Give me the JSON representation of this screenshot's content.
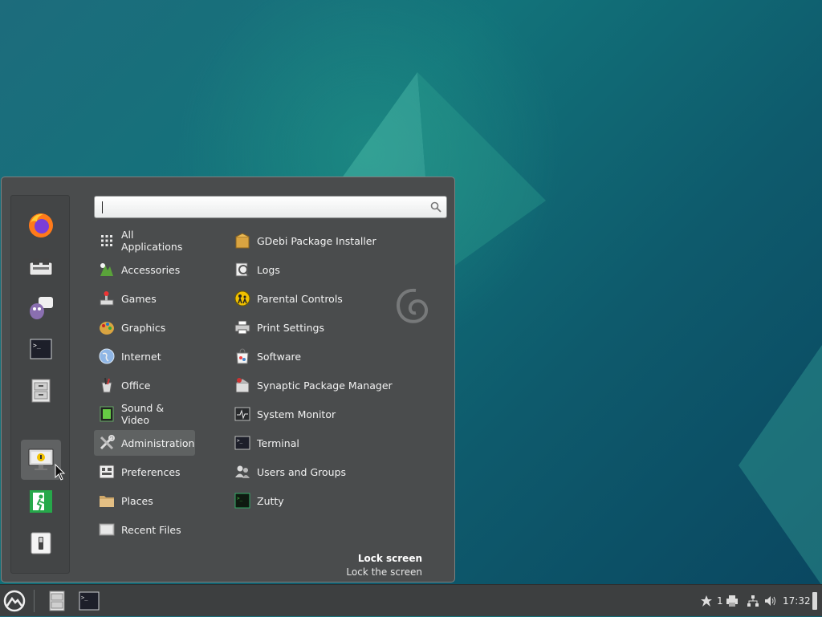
{
  "search": {
    "value": "",
    "placeholder": ""
  },
  "favorites": [
    {
      "name": "firefox",
      "icon": "firefox-icon"
    },
    {
      "name": "software-manager",
      "icon": "software-icon"
    },
    {
      "name": "pidgin",
      "icon": "pidgin-icon"
    },
    {
      "name": "terminal",
      "icon": "terminal-icon"
    },
    {
      "name": "files",
      "icon": "file-cabinet-icon"
    },
    {
      "name": "lock-screen",
      "icon": "lock-screen-icon"
    },
    {
      "name": "logout",
      "icon": "exit-icon"
    },
    {
      "name": "shutdown",
      "icon": "power-icon"
    }
  ],
  "categories": [
    {
      "label": "All Applications",
      "icon": "grid-icon"
    },
    {
      "label": "Accessories",
      "icon": "accessories-icon"
    },
    {
      "label": "Games",
      "icon": "games-icon"
    },
    {
      "label": "Graphics",
      "icon": "graphics-icon"
    },
    {
      "label": "Internet",
      "icon": "globe-icon"
    },
    {
      "label": "Office",
      "icon": "office-icon"
    },
    {
      "label": "Sound & Video",
      "icon": "multimedia-icon"
    },
    {
      "label": "Administration",
      "icon": "tools-icon",
      "selected": true
    },
    {
      "label": "Preferences",
      "icon": "preferences-icon"
    },
    {
      "label": "Places",
      "icon": "folder-icon"
    },
    {
      "label": "Recent Files",
      "icon": "recent-files-icon"
    }
  ],
  "apps": [
    {
      "label": "GDebi Package Installer",
      "icon": "package-icon"
    },
    {
      "label": "Logs",
      "icon": "logs-icon"
    },
    {
      "label": "Parental Controls",
      "icon": "parental-icon"
    },
    {
      "label": "Print Settings",
      "icon": "printer-icon"
    },
    {
      "label": "Software",
      "icon": "software-icon"
    },
    {
      "label": "Synaptic Package Manager",
      "icon": "synaptic-icon"
    },
    {
      "label": "System Monitor",
      "icon": "monitor-icon"
    },
    {
      "label": "Terminal",
      "icon": "terminal-icon"
    },
    {
      "label": "Users and Groups",
      "icon": "users-icon"
    },
    {
      "label": "Zutty",
      "icon": "zutty-icon"
    }
  ],
  "description": {
    "title": "Lock screen",
    "text": "Lock the screen"
  },
  "panel": {
    "notifications_count": "1",
    "clock": "17:32"
  },
  "colors": {
    "menu_bg": "#4a4c4d",
    "panel_bg": "#3d3f40",
    "selected": "#5f6262"
  }
}
